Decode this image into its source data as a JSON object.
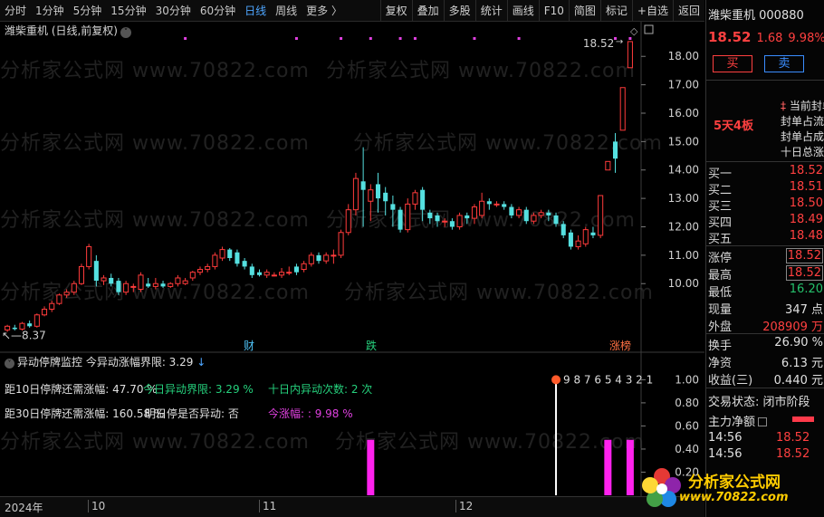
{
  "toolbar": {
    "periods": [
      "分时",
      "1分钟",
      "5分钟",
      "15分钟",
      "30分钟",
      "60分钟",
      "日线",
      "周线",
      "更多 〉"
    ],
    "active_period": "日线",
    "buttons": [
      "复权",
      "叠加",
      "多股",
      "统计",
      "画线",
      "F10",
      "简图",
      "标记",
      "+自选",
      "返回"
    ]
  },
  "chart": {
    "title": "潍柴重机 (日线,前复权)",
    "high_label": "18.52",
    "low_label": "8.37",
    "markers": [
      {
        "label": "财",
        "color": "#4fc3f7"
      },
      {
        "label": "跌",
        "color": "#26d07c"
      },
      {
        "label": "涨榜",
        "color": "#ff7043"
      }
    ],
    "y_axis": [
      "18.00",
      "17.00",
      "16.00",
      "15.00",
      "14.00",
      "13.00",
      "12.00",
      "11.00",
      "10.00"
    ]
  },
  "chart_data": {
    "type": "candlestick",
    "ylim": [
      8.0,
      18.9
    ],
    "up_color": "#ff3b3b",
    "down_color": "#55e0e0",
    "candles": [
      [
        8.37,
        8.5,
        8.3,
        8.55
      ],
      [
        8.45,
        8.4,
        8.35,
        8.55
      ],
      [
        8.4,
        8.6,
        8.35,
        8.65
      ],
      [
        8.6,
        8.5,
        8.45,
        8.7
      ],
      [
        8.5,
        8.9,
        8.45,
        8.95
      ],
      [
        8.9,
        9.1,
        8.85,
        9.2
      ],
      [
        9.1,
        9.3,
        9.0,
        9.4
      ],
      [
        9.3,
        9.6,
        9.25,
        9.65
      ],
      [
        9.6,
        9.7,
        9.5,
        9.8
      ],
      [
        9.7,
        10.0,
        9.6,
        10.1
      ],
      [
        10.0,
        10.6,
        9.95,
        10.7
      ],
      [
        10.6,
        11.3,
        10.5,
        11.4
      ],
      [
        10.8,
        10.1,
        9.9,
        11.0
      ],
      [
        10.1,
        10.2,
        9.95,
        10.3
      ],
      [
        10.2,
        10.0,
        9.9,
        10.35
      ],
      [
        10.1,
        9.7,
        9.6,
        10.2
      ],
      [
        9.7,
        10.0,
        9.6,
        10.1
      ],
      [
        9.9,
        9.9,
        9.7,
        10.0
      ],
      [
        9.8,
        10.3,
        9.7,
        10.4
      ],
      [
        10.0,
        9.9,
        9.85,
        10.2
      ],
      [
        9.9,
        10.0,
        9.8,
        10.2
      ],
      [
        10.0,
        9.9,
        9.85,
        10.1
      ],
      [
        9.9,
        10.0,
        9.85,
        10.05
      ],
      [
        10.0,
        10.2,
        9.9,
        10.3
      ],
      [
        10.0,
        10.1,
        9.95,
        10.2
      ],
      [
        10.2,
        10.4,
        10.1,
        10.45
      ],
      [
        10.4,
        10.5,
        10.3,
        10.6
      ],
      [
        10.5,
        10.6,
        10.4,
        10.7
      ],
      [
        10.6,
        11.0,
        10.5,
        11.1
      ],
      [
        10.9,
        11.2,
        10.8,
        11.3
      ],
      [
        11.2,
        10.9,
        10.8,
        11.25
      ],
      [
        11.1,
        10.7,
        10.6,
        11.2
      ],
      [
        10.8,
        10.6,
        10.5,
        10.9
      ],
      [
        10.6,
        10.3,
        10.2,
        10.7
      ],
      [
        10.4,
        10.3,
        10.25,
        10.5
      ],
      [
        10.3,
        10.4,
        10.2,
        10.5
      ],
      [
        10.3,
        10.3,
        10.25,
        10.4
      ],
      [
        10.3,
        10.4,
        10.2,
        10.55
      ],
      [
        10.4,
        10.4,
        10.3,
        10.6
      ],
      [
        10.6,
        10.4,
        10.3,
        10.7
      ],
      [
        10.5,
        10.7,
        10.4,
        10.8
      ],
      [
        10.7,
        11.0,
        10.6,
        11.1
      ],
      [
        11.0,
        10.8,
        10.7,
        11.1
      ],
      [
        10.8,
        11.0,
        10.7,
        11.1
      ],
      [
        11.0,
        11.0,
        10.7,
        11.2
      ],
      [
        11.0,
        11.8,
        10.9,
        11.9
      ],
      [
        11.8,
        12.6,
        11.7,
        12.8
      ],
      [
        12.6,
        13.7,
        12.4,
        13.9
      ],
      [
        13.6,
        13.3,
        12.0,
        14.8
      ],
      [
        12.9,
        13.3,
        12.2,
        13.5
      ],
      [
        13.5,
        13.0,
        12.5,
        13.9
      ],
      [
        13.2,
        12.9,
        12.4,
        13.4
      ],
      [
        12.8,
        12.6,
        12.0,
        13.1
      ],
      [
        12.6,
        11.9,
        11.8,
        12.7
      ],
      [
        11.9,
        12.8,
        11.8,
        13.0
      ],
      [
        12.8,
        13.2,
        12.6,
        13.3
      ],
      [
        13.3,
        12.6,
        12.2,
        13.4
      ],
      [
        12.5,
        12.3,
        12.1,
        12.6
      ],
      [
        12.4,
        12.2,
        12.0,
        12.5
      ],
      [
        12.2,
        12.2,
        12.0,
        12.3
      ],
      [
        12.2,
        12.0,
        11.9,
        12.3
      ],
      [
        12.0,
        12.4,
        11.9,
        12.5
      ],
      [
        12.4,
        12.3,
        12.1,
        12.5
      ],
      [
        12.3,
        12.7,
        12.1,
        12.8
      ],
      [
        12.4,
        12.9,
        12.3,
        13.2
      ],
      [
        12.9,
        12.8,
        12.6,
        13.0
      ],
      [
        12.8,
        12.8,
        12.7,
        12.9
      ],
      [
        12.8,
        12.7,
        12.6,
        12.9
      ],
      [
        12.7,
        12.4,
        12.3,
        12.8
      ],
      [
        12.4,
        12.6,
        12.3,
        12.7
      ],
      [
        12.6,
        12.2,
        12.1,
        12.7
      ],
      [
        12.2,
        12.4,
        12.1,
        12.5
      ],
      [
        12.4,
        12.5,
        12.3,
        12.6
      ],
      [
        12.5,
        12.4,
        12.2,
        12.6
      ],
      [
        12.4,
        12.1,
        12.0,
        12.5
      ],
      [
        12.1,
        11.7,
        11.6,
        12.2
      ],
      [
        11.8,
        11.3,
        11.2,
        11.9
      ],
      [
        11.3,
        11.5,
        11.2,
        11.7
      ],
      [
        11.4,
        11.9,
        11.3,
        12.0
      ],
      [
        11.8,
        11.7,
        11.6,
        12.0
      ],
      [
        11.7,
        13.1,
        11.6,
        13.1
      ],
      [
        14.0,
        14.3,
        14.0,
        14.3
      ],
      [
        15.0,
        14.4,
        13.9,
        15.3
      ],
      [
        15.4,
        16.9,
        15.4,
        16.9
      ],
      [
        17.6,
        18.52,
        17.6,
        18.52
      ]
    ],
    "limit_up_markers": [
      24,
      39,
      45,
      49,
      53,
      55,
      63,
      69,
      82,
      84
    ]
  },
  "indicator": {
    "header": "异动停牌监控  今异动涨幅界限: 3.29",
    "line1_a": "距10日停牌还需涨幅: 47.70 %",
    "line1_b": "今日异动界限: 3.29 %",
    "line1_c": "十日内异动次数: 2 次",
    "line2_a": "距30日停牌还需涨幅: 160.58 %",
    "line2_b": "明日停是否异动: 否",
    "line2_c": "今涨幅: : 9.98 %",
    "countdown": "9 8 7 6 5 4 3 2 1",
    "y_axis": [
      "1.00",
      "0.80",
      "0.60",
      "0.40",
      "0.20"
    ],
    "bars": [
      {
        "index": 49,
        "value": 0.48
      },
      {
        "index": 81,
        "value": 0.48
      },
      {
        "index": 84,
        "value": 0.48
      }
    ],
    "signal_index": 74,
    "signal_value": 1.0
  },
  "date_axis": [
    "2024年",
    "10",
    "11",
    "12"
  ],
  "quote": {
    "name": "潍柴重机 000880",
    "price": "18.52",
    "change": "1.68",
    "pct": "9.98%",
    "buy": "买",
    "sell": "卖",
    "board": "5天4板",
    "info_lines": [
      "当前封单",
      "封单占流",
      "封单占成",
      "十日总涨"
    ],
    "bids": [
      {
        "k": "买一",
        "v": "18.52"
      },
      {
        "k": "买二",
        "v": "18.51"
      },
      {
        "k": "买三",
        "v": "18.50"
      },
      {
        "k": "买四",
        "v": "18.49"
      },
      {
        "k": "买五",
        "v": "18.48"
      }
    ],
    "stats": [
      {
        "k": "涨停",
        "v": "18.52",
        "cls": "red boxed"
      },
      {
        "k": "最高",
        "v": "18.52",
        "cls": "red boxed"
      },
      {
        "k": "最低",
        "v": "16.20",
        "cls": "green"
      },
      {
        "k": "现量",
        "v": "347 点",
        "cls": "white"
      },
      {
        "k": "外盘",
        "v": "208909 万",
        "cls": "red"
      }
    ],
    "stats2": [
      {
        "k": "换手",
        "v": "26.90 %",
        "cls": "white"
      },
      {
        "k": "净资",
        "v": "6.13 元",
        "cls": "white"
      },
      {
        "k": "收益(三)",
        "v": "0.440 元",
        "cls": "white"
      }
    ],
    "status": "交易状态: 闭市阶段",
    "netin": "主力净额",
    "ticks": [
      {
        "t": "14:56",
        "v": "18.52"
      },
      {
        "t": "14:56",
        "v": "18.52"
      }
    ]
  },
  "watermark": "分析家公式网 www.70822.com",
  "logo": {
    "name": "分析家公式网",
    "url": "www.70822.com"
  }
}
